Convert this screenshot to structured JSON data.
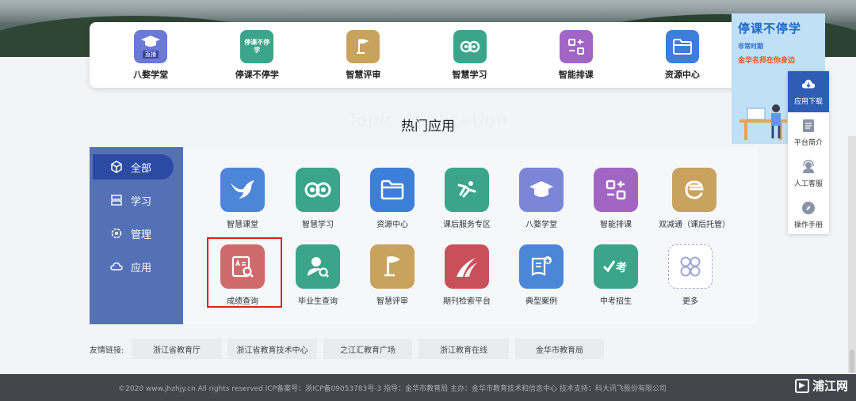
{
  "top_nav": [
    {
      "label": "八婺学堂",
      "icon": "graduation-cap-icon",
      "badge": "直播",
      "color": "#6b7ad6"
    },
    {
      "label": "停课不停学",
      "icon": "stop-class-icon",
      "badge": "停课不停学",
      "color": "#3aa58a"
    },
    {
      "label": "智慧评审",
      "icon": "flag-icon",
      "color": "#c9a25e"
    },
    {
      "label": "智慧学习",
      "icon": "owl-icon",
      "color": "#3aa58a"
    },
    {
      "label": "智能排课",
      "icon": "schedule-icon",
      "color": "#a166c4"
    },
    {
      "label": "资源中心",
      "icon": "folder-icon",
      "color": "#3d7ed8"
    }
  ],
  "heading": {
    "title": "热门应用",
    "subtitle": "Topic Application"
  },
  "sidebar": [
    {
      "label": "全部",
      "icon": "cube-icon",
      "active": true
    },
    {
      "label": "学习",
      "icon": "server-icon"
    },
    {
      "label": "管理",
      "icon": "settings-icon"
    },
    {
      "label": "应用",
      "icon": "cloud-icon"
    }
  ],
  "apps": [
    {
      "label": "智慧课堂",
      "icon": "bird-icon",
      "color": "#4d86d9"
    },
    {
      "label": "智慧学习",
      "icon": "owl-icon",
      "color": "#3aa58a"
    },
    {
      "label": "资源中心",
      "icon": "folder-icon",
      "color": "#3d7ed8"
    },
    {
      "label": "课后服务专区",
      "icon": "runner-icon",
      "color": "#3aa58a"
    },
    {
      "label": "八婺学堂",
      "icon": "graduation-cap-icon",
      "color": "#7b86d9"
    },
    {
      "label": "智能排课",
      "icon": "schedule-icon",
      "color": "#a166c4"
    },
    {
      "label": "双减通（课后托管）",
      "icon": "e-letter-icon",
      "color": "#c9a25e"
    },
    {
      "label": "成绩查询",
      "icon": "score-search-icon",
      "color": "#d06a6a"
    },
    {
      "label": "毕业生查询",
      "icon": "person-search-icon",
      "color": "#3aa58a"
    },
    {
      "label": "智慧评审",
      "icon": "flag-icon",
      "color": "#c9a25e"
    },
    {
      "label": "期刊检索平台",
      "icon": "journal-icon",
      "color": "#c9505a"
    },
    {
      "label": "典型案例",
      "icon": "case-icon",
      "color": "#4d86d9"
    },
    {
      "label": "中考招生",
      "icon": "exam-icon",
      "color": "#3aa58a"
    },
    {
      "label": "更多",
      "icon": "more-icon",
      "color": "#9fa8d6"
    }
  ],
  "friends": {
    "label": "友情链接:",
    "links": [
      "浙江省教育厅",
      "浙江省教育技术中心",
      "之江汇教育广场",
      "浙江教育在线",
      "金华市教育局"
    ]
  },
  "footer": {
    "text": "©2020 www.jhzhjy.cn All rights reserved ICP备案号：浙ICP备09053783号-3 指导：金华市教育局 主办：金华市教育技术和信息中心 技术支持：科大讯飞股份有限公司"
  },
  "watermark": "浦江网",
  "promo": {
    "title": "停课不停学",
    "line1": "非常时期",
    "line2": "金华名师在你身边"
  },
  "float_menu": [
    {
      "label": "应用下载",
      "icon": "download-cloud-icon",
      "active": true
    },
    {
      "label": "平台简介",
      "icon": "document-icon"
    },
    {
      "label": "人工客服",
      "icon": "headset-icon"
    },
    {
      "label": "操作手册",
      "icon": "compass-icon"
    }
  ],
  "colors": {
    "sidebar": "#5471b5",
    "sidebar_active": "#2c4aa3",
    "highlight": "#e02020",
    "footer": "#43464d"
  }
}
